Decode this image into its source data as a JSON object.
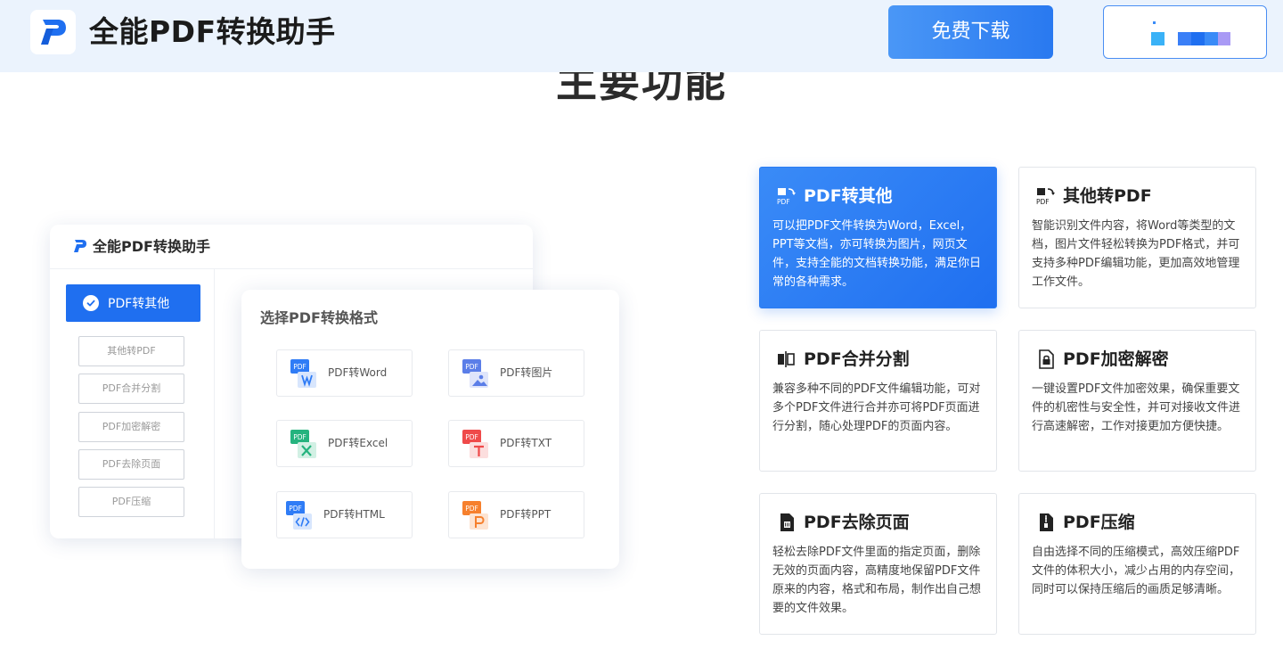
{
  "header": {
    "app_name": "全能PDF转换助手",
    "download_label": "免费下载"
  },
  "section": {
    "title": "主要功能"
  },
  "mockup": {
    "title": "全能PDF转换助手",
    "active_item": "PDF转其他",
    "side_items": [
      "其他转PDF",
      "PDF合并分割",
      "PDF加密解密",
      "PDF去除页面",
      "PDF压缩"
    ],
    "card_title": "选择PDF转换格式",
    "formats": [
      {
        "label": "PDF转Word",
        "color": "#2f7cf6",
        "icon": "word-icon"
      },
      {
        "label": "PDF转图片",
        "color": "#5b7ee8",
        "icon": "image-icon"
      },
      {
        "label": "PDF转Excel",
        "color": "#25b37e",
        "icon": "excel-icon"
      },
      {
        "label": "PDF转TXT",
        "color": "#ef4a4a",
        "icon": "txt-icon"
      },
      {
        "label": "PDF转HTML",
        "color": "#2f7cf6",
        "icon": "html-icon"
      },
      {
        "label": "PDF转PPT",
        "color": "#f6802d",
        "icon": "ppt-icon"
      }
    ]
  },
  "features": [
    {
      "title": "PDF转其他",
      "icon": "pdf-to-other-icon",
      "active": true,
      "desc": "可以把PDF文件转换为Word，Excel，PPT等文档，亦可转换为图片，网页文件，支持全能的文档转换功能，满足你日常的各种需求。"
    },
    {
      "title": "其他转PDF",
      "icon": "other-to-pdf-icon",
      "active": false,
      "desc": "智能识别文件内容，将Word等类型的文档，图片文件轻松转换为PDF格式，并可支持多种PDF编辑功能，更加高效地管理工作文件。"
    },
    {
      "title": "PDF合并分割",
      "icon": "merge-split-icon",
      "active": false,
      "desc": "兼容多种不同的PDF文件编辑功能，可对多个PDF文件进行合并亦可将PDF页面进行分割，随心处理PDF的页面内容。"
    },
    {
      "title": "PDF加密解密",
      "icon": "lock-icon",
      "active": false,
      "desc": "一键设置PDF文件加密效果，确保重要文件的机密性与安全性，并可对接收文件进行高速解密，工作对接更加方便快捷。"
    },
    {
      "title": "PDF去除页面",
      "icon": "delete-page-icon",
      "active": false,
      "desc": "轻松去除PDF文件里面的指定页面，删除无效的页面内容，高精度地保留PDF文件原来的内容，格式和布局，制作出自己想要的文件效果。"
    },
    {
      "title": "PDF压缩",
      "icon": "compress-icon",
      "active": false,
      "desc": "自由选择不同的压缩模式，高效压缩PDF文件的体积大小，减少占用的内存空间，同时可以保持压缩后的画质足够清晰。"
    }
  ]
}
